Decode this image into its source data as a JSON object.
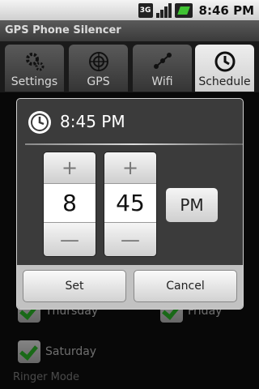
{
  "status_bar": {
    "network": "3G",
    "time": "8:46 PM"
  },
  "app": {
    "title": "GPS Phone Silencer"
  },
  "tabs": [
    {
      "label": "Settings",
      "icon": "gears-icon",
      "active": false
    },
    {
      "label": "GPS",
      "icon": "radar-icon",
      "active": false
    },
    {
      "label": "Wifi",
      "icon": "wifi-icon",
      "active": false
    },
    {
      "label": "Schedule",
      "icon": "clock-icon",
      "active": true
    }
  ],
  "background": {
    "days": [
      {
        "label": "Thursday",
        "checked": true
      },
      {
        "label": "Friday",
        "checked": true
      },
      {
        "label": "Saturday",
        "checked": true
      }
    ],
    "section_label": "Ringer Mode"
  },
  "dialog": {
    "title": "8:45 PM",
    "hour": "8",
    "minute": "45",
    "plus": "+",
    "minus": "—",
    "ampm": "PM",
    "set_label": "Set",
    "cancel_label": "Cancel"
  },
  "colors": {
    "accent": "#2fc02a",
    "active_tab": "#e0e0e0"
  }
}
